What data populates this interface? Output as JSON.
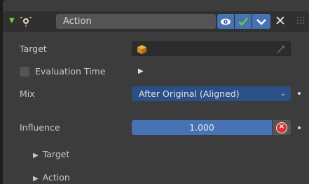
{
  "modifier": {
    "name": "Action",
    "accent_color": "#7ec63c",
    "toggle_color": "#4772b3",
    "icons": {
      "expand": "triangle-down-icon",
      "type": "action-constraint-icon",
      "eye": "eye-icon",
      "enabled": "check-icon",
      "more": "chevron-down-icon",
      "close": "close-icon",
      "grip": "drag-grip-icon"
    },
    "close_glyph": "✕"
  },
  "fields": {
    "target_label": "Target",
    "evaluation_time_label": "Evaluation Time",
    "mix_label": "Mix",
    "mix_value": "After Original (Aligned)",
    "influence_label": "Influence",
    "influence_value": "1.000"
  },
  "subpanels": [
    {
      "label": "Target"
    },
    {
      "label": "Action"
    }
  ]
}
